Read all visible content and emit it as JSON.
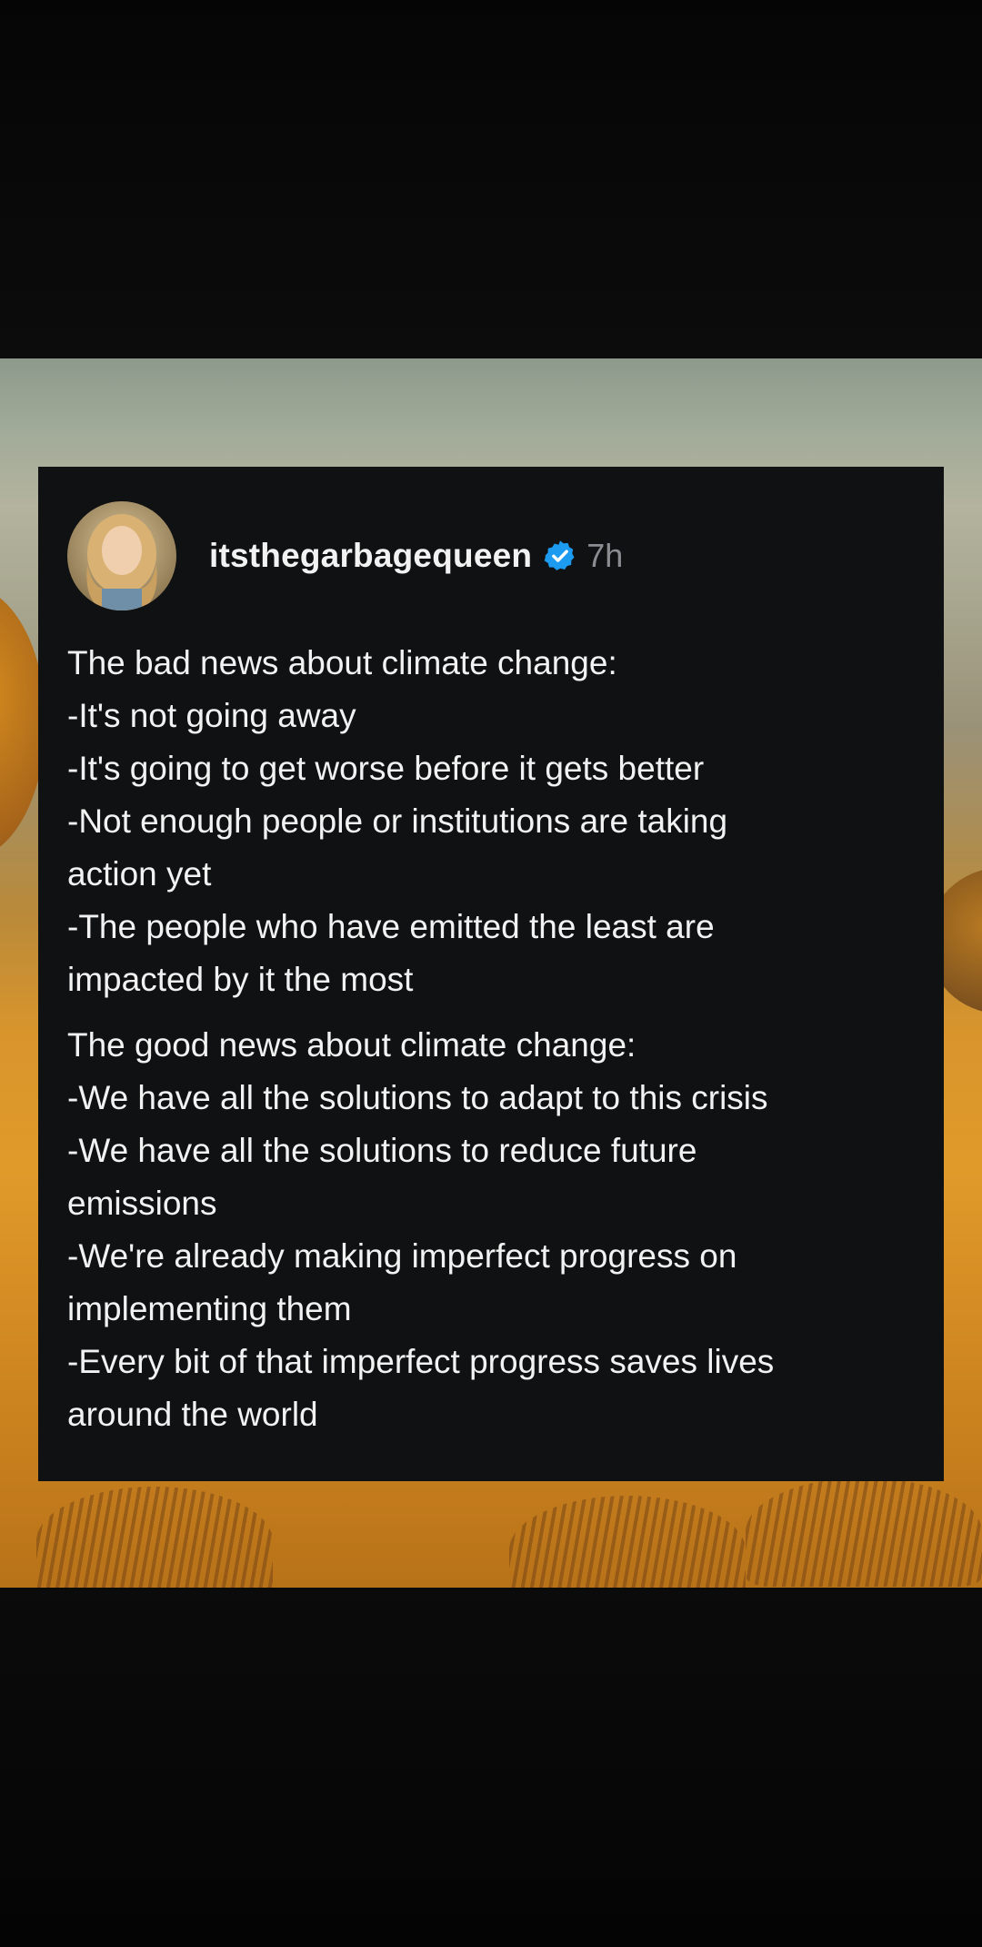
{
  "post": {
    "username": "itsthegarbagequeen",
    "timestamp": "7h",
    "verified_icon": "verified-badge-icon",
    "accent_color": "#1d9bf0",
    "paragraphs": [
      {
        "lines": [
          "The bad news about climate change:",
          "-It's not going away",
          "-It's going to get worse before it gets better",
          "-Not enough people or institutions are taking",
          "action yet",
          "-The people who have emitted the least are",
          "impacted by it the most"
        ]
      },
      {
        "lines": [
          "The good news about climate change:",
          "-We have all the solutions to adapt to this crisis",
          "-We have all the solutions to reduce future",
          "emissions",
          "-We're already making imperfect progress on",
          "implementing them",
          "-Every bit of that imperfect progress saves lives",
          "around the world"
        ]
      }
    ]
  }
}
